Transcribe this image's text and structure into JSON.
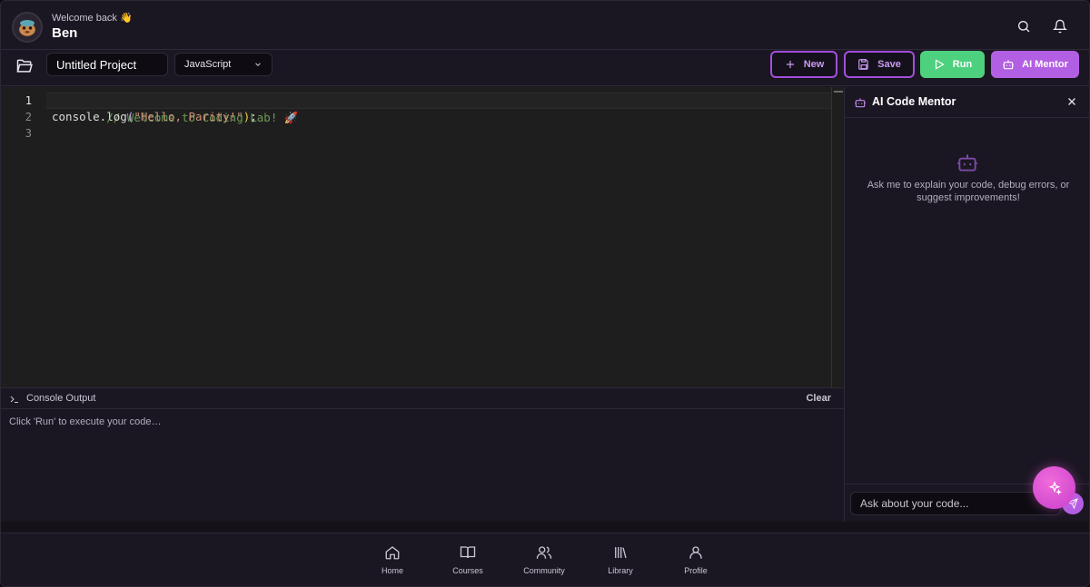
{
  "header": {
    "welcome": "Welcome back 👋",
    "username": "Ben",
    "search_icon": "search-icon",
    "bell_icon": "bell-icon"
  },
  "toolbar": {
    "project_name": "Untitled Project",
    "language": "JavaScript",
    "new_label": "New",
    "save_label": "Save",
    "run_label": "Run",
    "ai_label": "AI Mentor"
  },
  "editor": {
    "line_numbers": [
      "1",
      "2",
      "3"
    ],
    "line1": "// Welcome to Coding Lab! 🚀",
    "line2_ident": "console.log",
    "line2_open": "(",
    "line2_str": "\"Hello, Parity!\"",
    "line2_close": ")",
    "line2_end": ";"
  },
  "console": {
    "title": "Console Output",
    "clear_label": "Clear",
    "placeholder_output": "Click 'Run' to execute your code…"
  },
  "ai_panel": {
    "title": "AI Code Mentor",
    "empty_text": "Ask me to explain your code, debug errors, or suggest improvements!",
    "input_placeholder": "Ask about your code..."
  },
  "bottom_nav": {
    "items": [
      {
        "label": "Home",
        "icon": "home-icon"
      },
      {
        "label": "Courses",
        "icon": "book-icon"
      },
      {
        "label": "Community",
        "icon": "users-icon"
      },
      {
        "label": "Library",
        "icon": "library-icon"
      },
      {
        "label": "Profile",
        "icon": "user-icon"
      }
    ]
  },
  "colors": {
    "accent_purple": "#b35fe3",
    "run_green": "#4ed17e",
    "background": "#1a1622",
    "editor_bg": "#1e1e1e"
  }
}
